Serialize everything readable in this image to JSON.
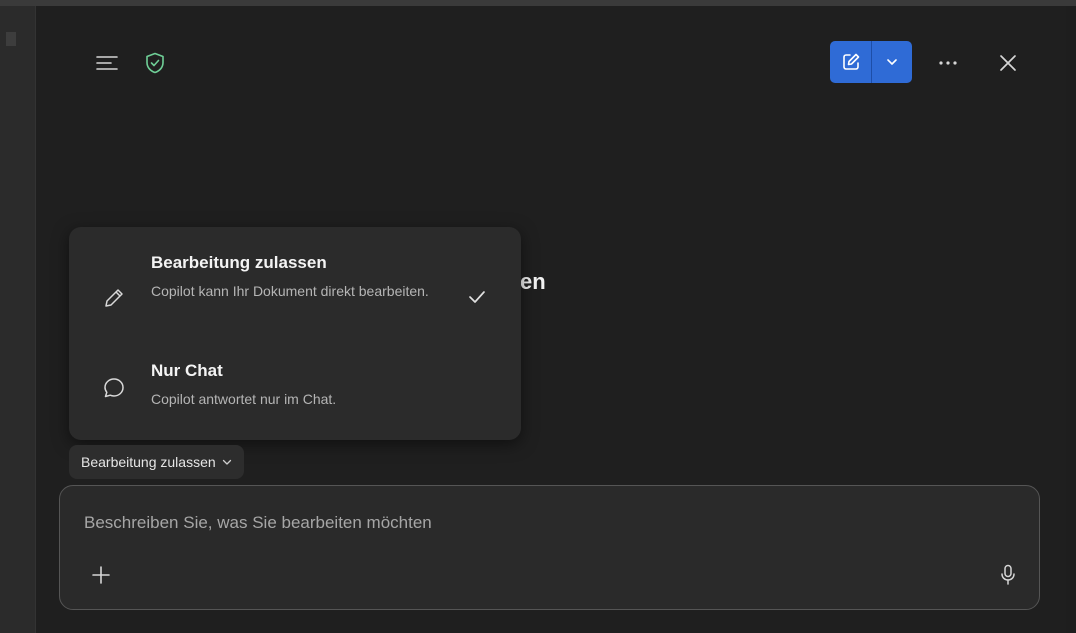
{
  "header": {
    "menu_icon": "hamburger-menu-icon",
    "shield_icon": "shield-check-icon",
    "new_chat_icon": "compose-icon",
    "new_chat_dropdown_icon": "chevron-down-icon",
    "more_icon": "more-horizontal-icon",
    "close_icon": "close-icon"
  },
  "behind_title_fragment": "en",
  "mode_menu": {
    "options": [
      {
        "title": "Bearbeitung zulassen",
        "description": "Copilot kann Ihr Dokument direkt bearbeiten.",
        "icon": "pencil-icon",
        "selected": true
      },
      {
        "title": "Nur Chat",
        "description": "Copilot antwortet nur im Chat.",
        "icon": "chat-bubble-icon",
        "selected": false
      }
    ]
  },
  "mode_selector": {
    "label": "Bearbeitung zulassen"
  },
  "composer": {
    "placeholder": "Beschreiben Sie, was Sie bearbeiten möchten",
    "value": ""
  },
  "colors": {
    "accent": "#2f6bd6",
    "shield": "#6fcf97",
    "background": "#1f1f1f",
    "popup": "#2b2b2b"
  }
}
